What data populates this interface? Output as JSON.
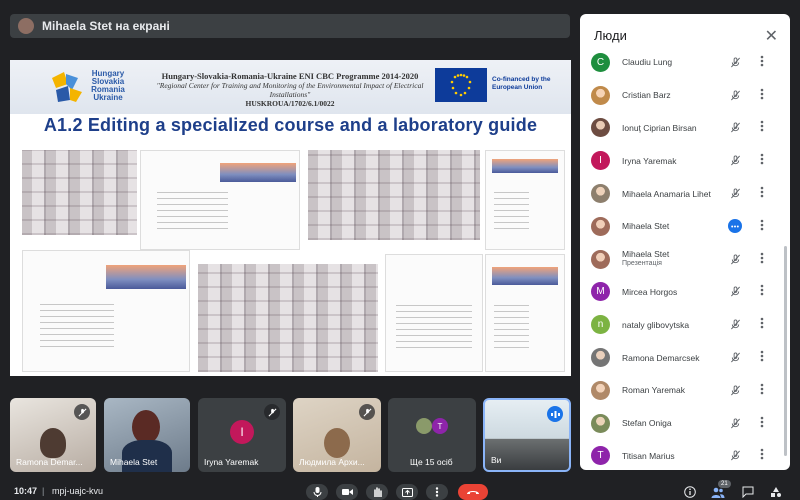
{
  "presenter_bar": {
    "label": "Mihaela Stet на екрані"
  },
  "slide": {
    "logo_text": [
      "Hungary",
      "Slovakia",
      "Romania",
      "Ukraine"
    ],
    "programme_line1": "Hungary-Slovakia-Romania-Ukraine ENI CBC Programme 2014-2020",
    "programme_line2": "\"Regional Center for Training and Monitoring of the Environmental Impact of Electrical Installations\"",
    "programme_line3": "HUSKROUA/1702/6.1/0022",
    "eu_text": "Co-financed by the European Union",
    "title": "A1.2 Editing a specialized course and a laboratory guide"
  },
  "people_panel": {
    "title": "Люди",
    "participants": [
      {
        "initial": "C",
        "name": "Claudiu Lung",
        "subtitle": "",
        "avatar_color": "#1e8e3e",
        "status": "muted"
      },
      {
        "initial": "",
        "name": "Cristian Barz",
        "subtitle": "",
        "avatar_color": "#c08a4a",
        "status": "muted"
      },
      {
        "initial": "",
        "name": "Ionuţ Ciprian Birsan",
        "subtitle": "",
        "avatar_color": "#6d4c41",
        "status": "muted"
      },
      {
        "initial": "I",
        "name": "Iryna Yaremak",
        "subtitle": "",
        "avatar_color": "#c2185b",
        "status": "muted"
      },
      {
        "initial": "",
        "name": "Mihaela Anamaria Lihet",
        "subtitle": "",
        "avatar_color": "#8d7f6d",
        "status": "muted"
      },
      {
        "initial": "",
        "name": "Mihaela Stet",
        "subtitle": "",
        "avatar_color": "#9e6b5a",
        "status": "speaking"
      },
      {
        "initial": "",
        "name": "Mihaela Stet",
        "subtitle": "Презентація",
        "avatar_color": "#9e6b5a",
        "status": "muted"
      },
      {
        "initial": "M",
        "name": "Mircea Horgos",
        "subtitle": "",
        "avatar_color": "#8e24aa",
        "status": "muted"
      },
      {
        "initial": "n",
        "name": "nataly glibovytska",
        "subtitle": "",
        "avatar_color": "#7cb342",
        "status": "muted"
      },
      {
        "initial": "",
        "name": "Ramona Demarcsek",
        "subtitle": "",
        "avatar_color": "#757575",
        "status": "muted"
      },
      {
        "initial": "",
        "name": "Roman Yaremak",
        "subtitle": "",
        "avatar_color": "#b08968",
        "status": "muted"
      },
      {
        "initial": "",
        "name": "Stefan Oniga",
        "subtitle": "",
        "avatar_color": "#7a8b5a",
        "status": "muted"
      },
      {
        "initial": "T",
        "name": "Titisan Marius",
        "subtitle": "",
        "avatar_color": "#8e24aa",
        "status": "muted"
      }
    ]
  },
  "tiles": [
    {
      "name": "Ramona Demar...",
      "kind": "video"
    },
    {
      "name": "Mihaela Stet",
      "kind": "video"
    },
    {
      "name": "Iryna Yaremak",
      "kind": "avatar",
      "initial": "I",
      "avatar_color": "#c2185b"
    },
    {
      "name": "Людмила Архи...",
      "kind": "video"
    },
    {
      "name": "Ще 15 осіб",
      "kind": "more",
      "initial": "T",
      "avatar_color": "#8e24aa"
    },
    {
      "name": "Ви",
      "kind": "self"
    }
  ],
  "bottom_bar": {
    "time": "10:47",
    "separator": "|",
    "meeting_code": "mpj-uajc-kvu",
    "participant_count": "21"
  },
  "colors": {
    "muted": "#5f6368",
    "active": "#1a73e8",
    "end_call": "#ea4335"
  }
}
